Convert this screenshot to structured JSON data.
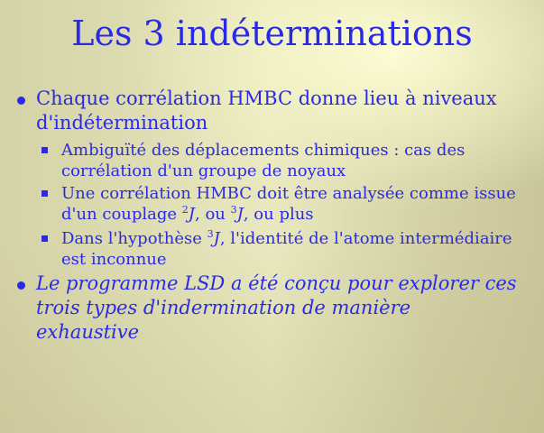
{
  "slide": {
    "title": "Les 3 indéterminations",
    "bullets": [
      {
        "text": "Chaque corrélation HMBC donne lieu à niveaux d'indétermination",
        "sub": [
          {
            "text": "Ambiguïté des déplacements chimiques : cas des corrélation d'un groupe de noyaux"
          },
          {
            "parts": {
              "a": "Une corrélation HMBC doit être analysée comme issue d'un couplage ",
              "sup1": "2",
              "j1": "J",
              "b": ", ou ",
              "sup2": "3",
              "j2": "J",
              "c": ", ou plus"
            }
          },
          {
            "parts": {
              "a": "Dans l'hypothèse ",
              "sup1": "3",
              "j1": "J",
              "b": ", l'identité de l'atome intermédiaire est inconnue"
            }
          }
        ]
      },
      {
        "text": "Le programme LSD a été conçu pour explorer ces trois types d'indermination de manière exhaustive",
        "italic": true
      }
    ]
  },
  "colors": {
    "text": "#2a2ae6",
    "background_center": "#fafad2",
    "background_edge": "#c8c69a"
  },
  "icons": {
    "level1_bullet": "filled-circle",
    "level2_bullet": "filled-square"
  }
}
